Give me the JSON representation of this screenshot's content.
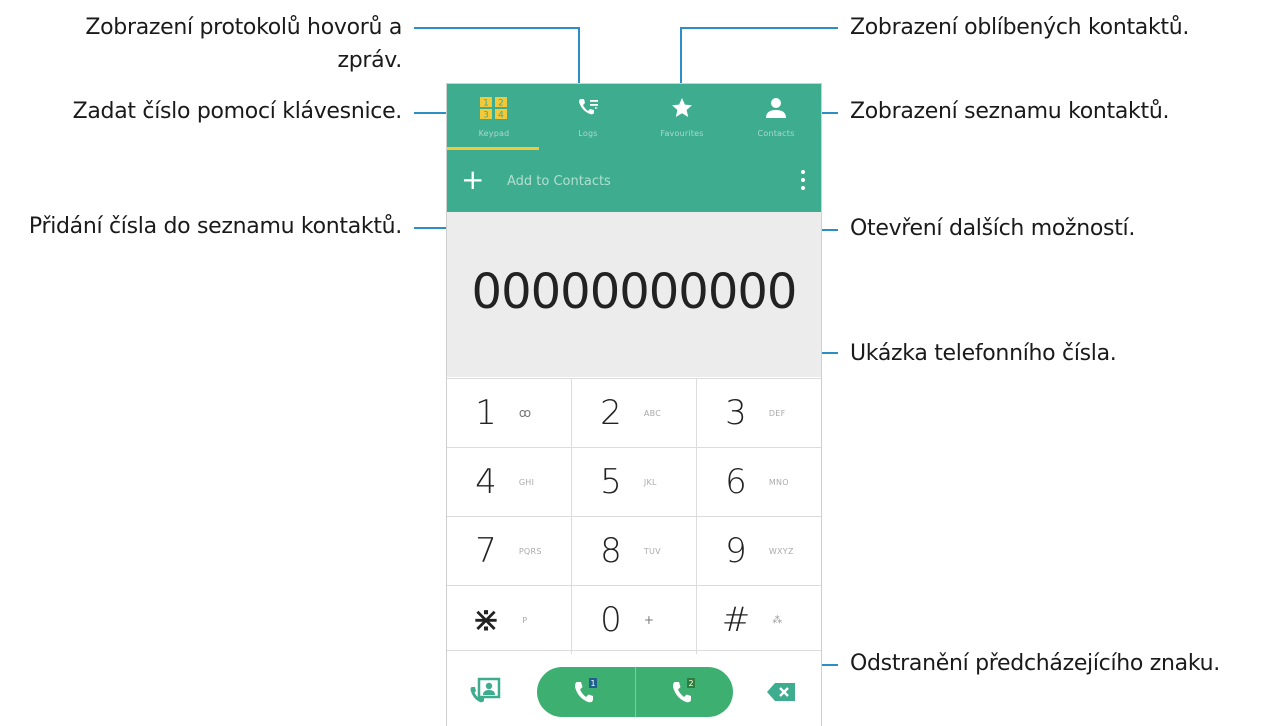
{
  "callouts": {
    "logs": "Zobrazení protokolů hovorů a",
    "logs2": "zpráv.",
    "keypad": "Zadat číslo pomocí klávesnice.",
    "add": "Přidání čísla do seznamu kontaktů.",
    "favorites": "Zobrazení oblíbených kontaktů.",
    "contacts": "Zobrazení seznamu kontaktů.",
    "more": "Otevření dalších možností.",
    "preview": "Ukázka telefonního čísla.",
    "delete": "Odstranění předcházejícího znaku."
  },
  "tabs": [
    {
      "label": "Keypad",
      "icon": "keypad-icon"
    },
    {
      "label": "Logs",
      "icon": "call-log-icon"
    },
    {
      "label": "Favourites",
      "icon": "star-icon"
    },
    {
      "label": "Contacts",
      "icon": "person-icon"
    }
  ],
  "action_bar": {
    "add_label": "Add to Contacts",
    "plus": "+"
  },
  "display": {
    "number": "00000000000"
  },
  "keys": [
    [
      {
        "d": "1",
        "s": "ꝏ"
      },
      {
        "d": "2",
        "s": "ABC"
      },
      {
        "d": "3",
        "s": "DEF"
      }
    ],
    [
      {
        "d": "4",
        "s": "GHI"
      },
      {
        "d": "5",
        "s": "JKL"
      },
      {
        "d": "6",
        "s": "MNO"
      }
    ],
    [
      {
        "d": "7",
        "s": "PQRS"
      },
      {
        "d": "8",
        "s": "TUV"
      },
      {
        "d": "9",
        "s": "WXYZ"
      }
    ],
    [
      {
        "d": "⋇",
        "s": "P"
      },
      {
        "d": "0",
        "s": "+"
      },
      {
        "d": "#",
        "s": "⁂"
      }
    ]
  ],
  "sims": [
    "1",
    "2"
  ],
  "colors": {
    "accent": "#3eac8f",
    "call": "#3db071",
    "callout_line": "#2b8fc4",
    "tab_indicator": "#f3c93a"
  }
}
